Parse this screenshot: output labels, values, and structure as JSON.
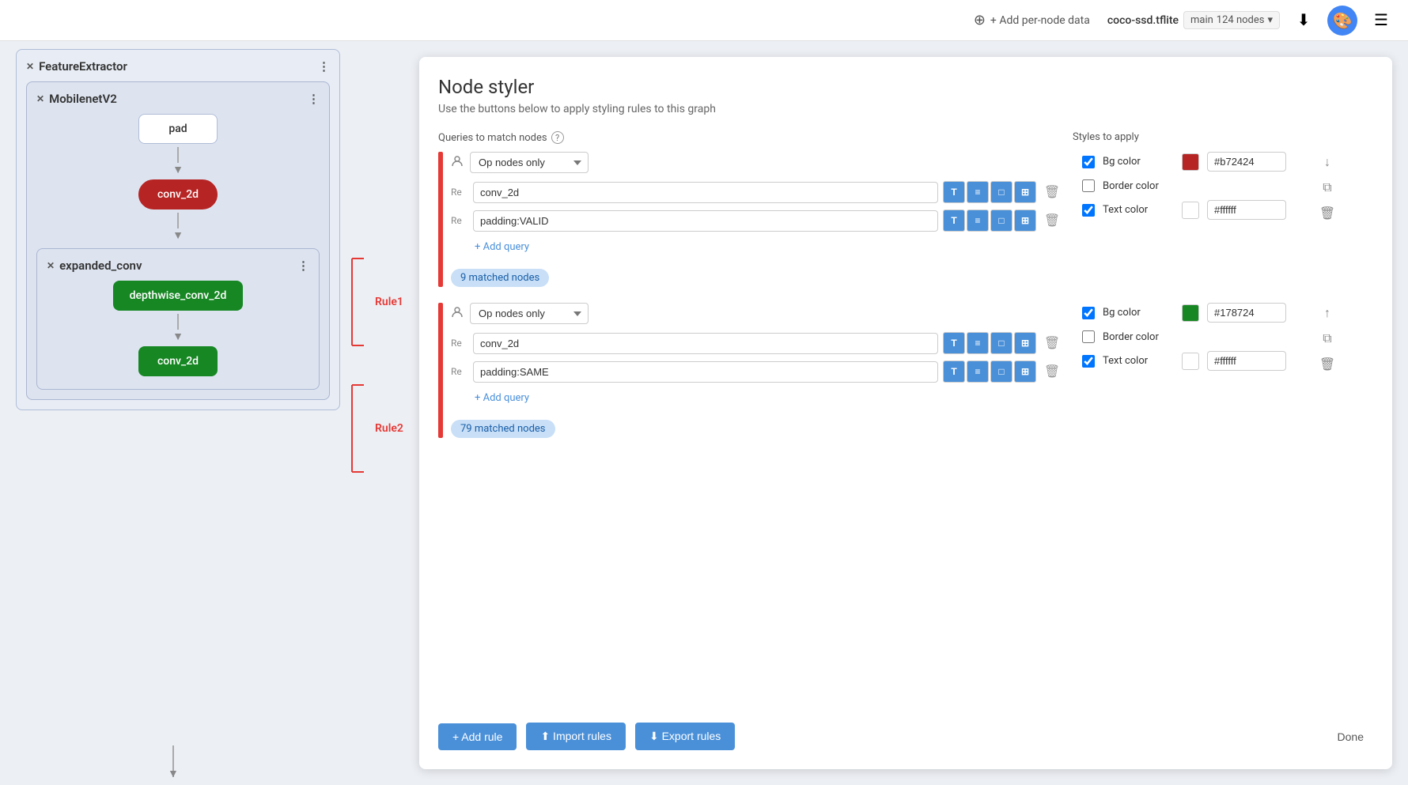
{
  "topbar": {
    "add_per_node_data": "+ Add per-node data",
    "model_name": "coco-ssd.tflite",
    "branch": "main",
    "node_count": "124 nodes",
    "palette_icon": "🎨",
    "menu_icon": "☰",
    "download_icon": "⬇"
  },
  "panel": {
    "title": "Node styler",
    "subtitle": "Use the buttons below to apply styling rules to this graph",
    "queries_header": "Queries to match nodes",
    "styles_header": "Styles to apply",
    "add_rule_label": "+ Add rule",
    "import_rules_label": "⬆ Import rules",
    "export_rules_label": "⬇ Export rules",
    "done_label": "Done"
  },
  "rules": [
    {
      "id": "Rule1",
      "label": "Rule1",
      "query_type": "Op nodes only",
      "queries": [
        {
          "prefix": "Re",
          "value": "conv_2d"
        },
        {
          "prefix": "Re",
          "value": "padding:VALID"
        }
      ],
      "add_query_label": "+ Add query",
      "matched_nodes": "9 matched nodes",
      "styles": {
        "bg_color": {
          "checked": true,
          "label": "Bg color",
          "color": "#b72424",
          "value": "#b72424"
        },
        "border_color": {
          "checked": false,
          "label": "Border color",
          "color": "",
          "value": ""
        },
        "text_color": {
          "checked": true,
          "label": "Text color",
          "color": "#ffffff",
          "value": "#ffffff"
        }
      },
      "actions": [
        "down",
        "copy",
        "delete"
      ]
    },
    {
      "id": "Rule2",
      "label": "Rule2",
      "query_type": "Op nodes only",
      "queries": [
        {
          "prefix": "Re",
          "value": "conv_2d"
        },
        {
          "prefix": "Re",
          "value": "padding:SAME"
        }
      ],
      "add_query_label": "+ Add query",
      "matched_nodes": "79 matched nodes",
      "styles": {
        "bg_color": {
          "checked": true,
          "label": "Bg color",
          "color": "#178724",
          "value": "#178724"
        },
        "border_color": {
          "checked": false,
          "label": "Border color",
          "color": "",
          "value": ""
        },
        "text_color": {
          "checked": true,
          "label": "Text color",
          "color": "#ffffff",
          "value": "#ffffff"
        }
      },
      "actions": [
        "up",
        "copy",
        "delete"
      ]
    }
  ],
  "graph": {
    "feature_extractor": "FeatureExtractor",
    "mobilenet_v2": "MobilenetV2",
    "expanded_conv": "expanded_conv",
    "nodes": {
      "pad": "pad",
      "conv_2d_red": "conv_2d",
      "depthwise_conv_2d": "depthwise_conv_2d",
      "conv_2d_green": "conv_2d"
    }
  },
  "graph_rule_labels": {
    "rule1": "Rule1",
    "rule2": "Rule2"
  },
  "query_btn_labels": {
    "T": "T",
    "list": "≡",
    "single": "□",
    "multi": "⊞"
  }
}
